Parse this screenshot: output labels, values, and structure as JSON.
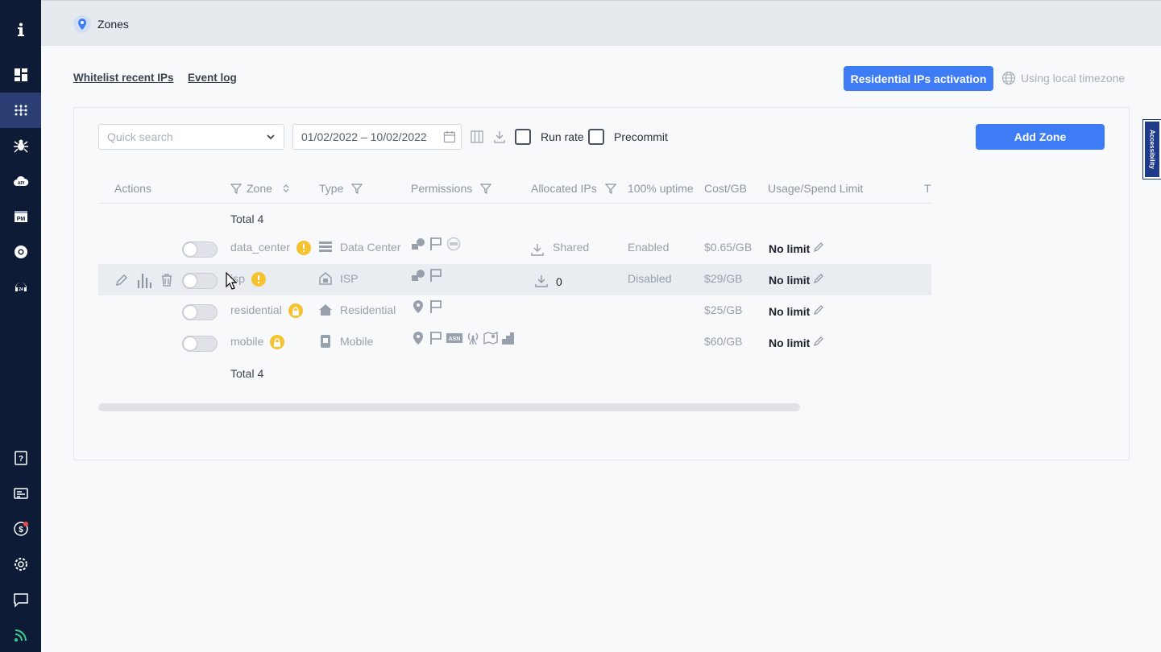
{
  "sidebar": {
    "items": [
      {
        "icon": "info-icon"
      },
      {
        "icon": "dashboard-icon"
      },
      {
        "icon": "proxy-network-icon",
        "active": true
      },
      {
        "icon": "scraper-spider-icon"
      },
      {
        "icon": "api-cloud-icon",
        "label": "API"
      },
      {
        "icon": "proxy-manager-icon",
        "label": "PM"
      },
      {
        "icon": "chrome-extension-icon"
      },
      {
        "icon": "support-24-icon"
      },
      {
        "icon": "help-icon"
      },
      {
        "icon": "billing-icon"
      },
      {
        "icon": "payments-icon"
      },
      {
        "icon": "settings-icon"
      },
      {
        "icon": "chat-icon"
      },
      {
        "icon": "rss-feed-icon"
      }
    ]
  },
  "header": {
    "title": "Zones"
  },
  "links": {
    "whitelist": "Whitelist recent IPs",
    "event_log": "Event log"
  },
  "buttons": {
    "residential_activation": "Residential IPs activation",
    "add_zone": "Add Zone"
  },
  "timezone": "Using local timezone",
  "toolbar": {
    "search_placeholder": "Quick search",
    "date_range": "01/02/2022 – 10/02/2022",
    "run_rate": "Run rate",
    "precommit": "Precommit"
  },
  "table": {
    "headers": [
      "Actions",
      "Zone",
      "Type",
      "Permissions",
      "Allocated IPs",
      "100% uptime",
      "Cost/GB",
      "Usage/Spend Limit",
      "Tr"
    ],
    "total_label": "Total 4",
    "rows": [
      {
        "zone": "data_center",
        "badge": "warning",
        "type": "Data Center",
        "allocated": "Shared",
        "uptime": "Enabled",
        "cost": "$0.65/GB",
        "limit": "No limit"
      },
      {
        "zone": "isp",
        "badge": "warning",
        "type": "ISP",
        "allocated": "0",
        "uptime": "Disabled",
        "cost": "$29/GB",
        "limit": "No limit"
      },
      {
        "zone": "residential",
        "badge": "lock",
        "type": "Residential",
        "allocated": "",
        "uptime": "",
        "cost": "$25/GB",
        "limit": "No limit"
      },
      {
        "zone": "mobile",
        "badge": "lock",
        "type": "Mobile",
        "allocated": "",
        "uptime": "",
        "cost": "$60/GB",
        "limit": "No limit"
      }
    ]
  },
  "accessibility": "Accessibility",
  "colors": {
    "sidebar": "#0d1b36",
    "primary": "#3d7cf5",
    "badge": "#f5c230"
  }
}
